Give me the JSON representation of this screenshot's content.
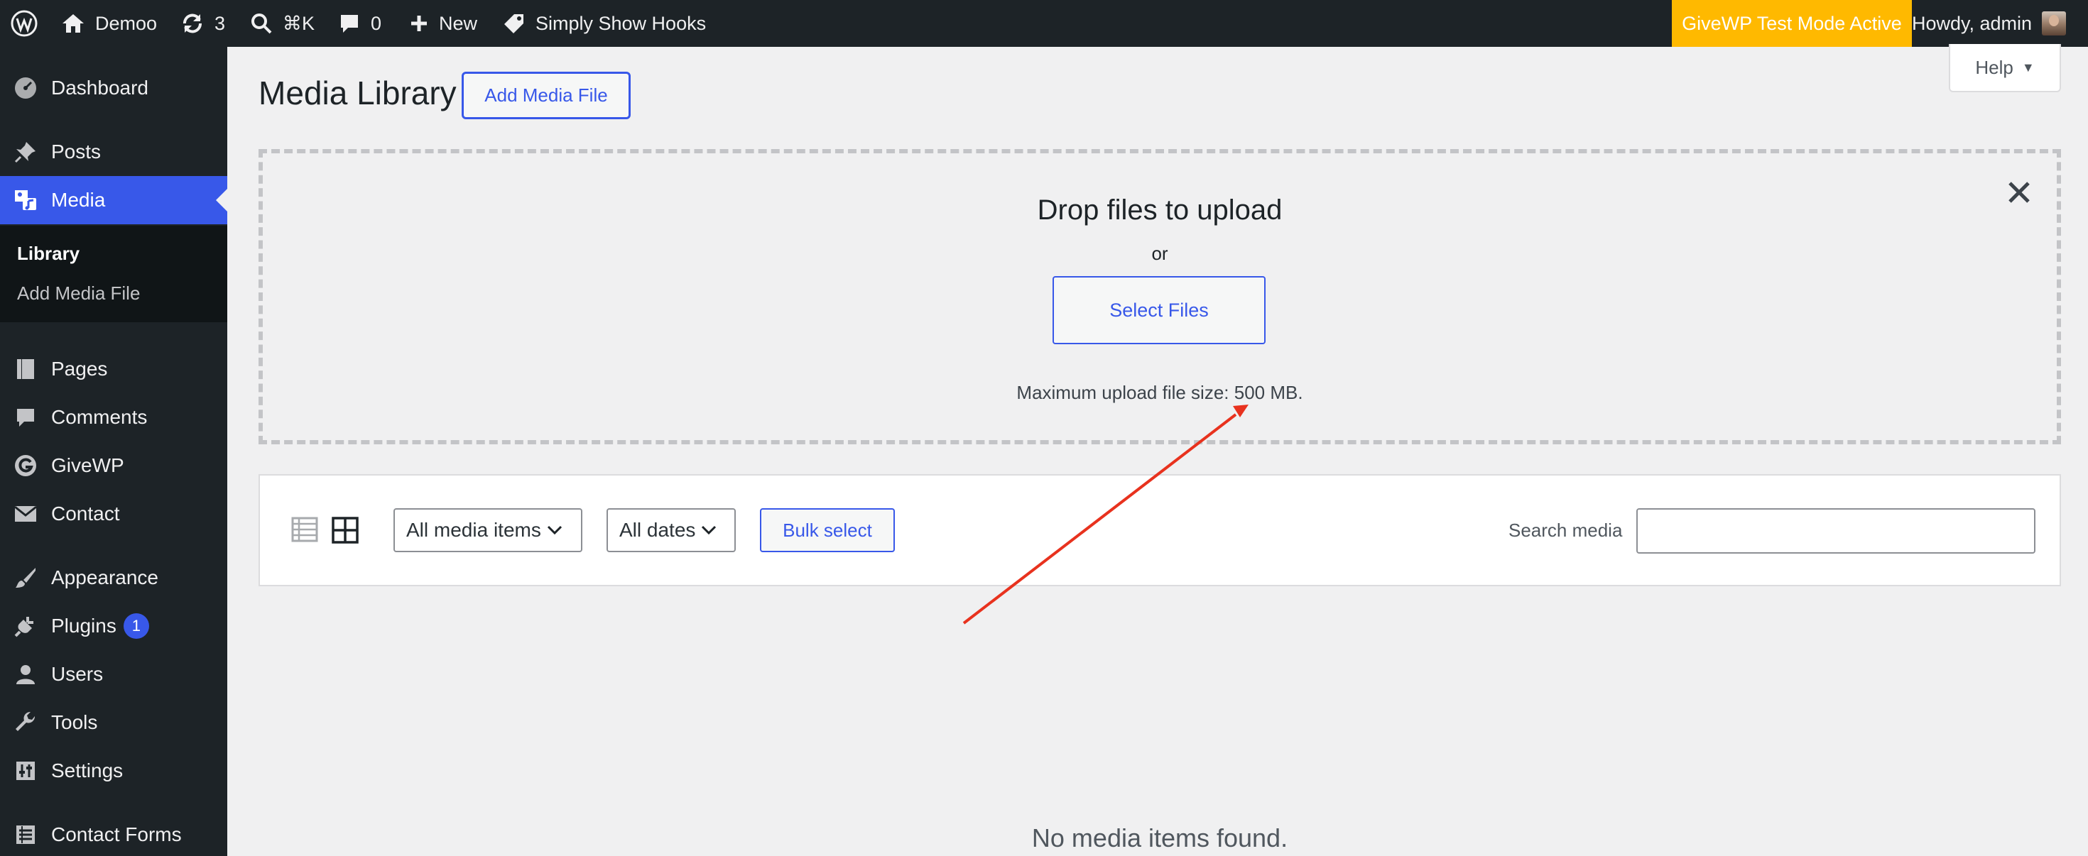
{
  "admin_bar": {
    "site_name": "Demoo",
    "updates_count": "3",
    "search_shortcut": "⌘K",
    "comments_count": "0",
    "new_label": "New",
    "plugin_label": "Simply Show Hooks",
    "givewp_notice": "GiveWP Test Mode Active",
    "howdy": "Howdy, admin"
  },
  "sidebar": {
    "items": [
      {
        "label": "Dashboard",
        "icon": "dashboard-icon"
      },
      {
        "label": "Posts",
        "icon": "pin-icon"
      },
      {
        "label": "Media",
        "icon": "media-icon",
        "current": true
      },
      {
        "label": "Pages",
        "icon": "pages-icon"
      },
      {
        "label": "Comments",
        "icon": "comments-icon"
      },
      {
        "label": "GiveWP",
        "icon": "givewp-icon"
      },
      {
        "label": "Contact",
        "icon": "envelope-icon"
      },
      {
        "label": "Appearance",
        "icon": "brush-icon"
      },
      {
        "label": "Plugins",
        "icon": "plug-icon",
        "badge": "1"
      },
      {
        "label": "Users",
        "icon": "user-icon"
      },
      {
        "label": "Tools",
        "icon": "wrench-icon"
      },
      {
        "label": "Settings",
        "icon": "sliders-icon"
      },
      {
        "label": "Contact Forms",
        "icon": "forms-icon"
      }
    ],
    "submenu": [
      {
        "label": "Library",
        "current": true
      },
      {
        "label": "Add Media File"
      }
    ]
  },
  "main": {
    "title": "Media Library",
    "add_button": "Add Media File",
    "help_button": "Help"
  },
  "uploader": {
    "title": "Drop files to upload",
    "or": "or",
    "select_files": "Select Files",
    "max_size": "Maximum upload file size: 500 MB."
  },
  "toolbar": {
    "type_filter": "All media items",
    "date_filter": "All dates",
    "bulk_select": "Bulk select",
    "search_label": "Search media",
    "search_value": ""
  },
  "empty_message": "No media items found.",
  "colors": {
    "accent": "#3858e9",
    "admin_bar": "#1d2327",
    "givewp_notice": "#ffb900",
    "annotation_arrow": "#e8321e"
  }
}
